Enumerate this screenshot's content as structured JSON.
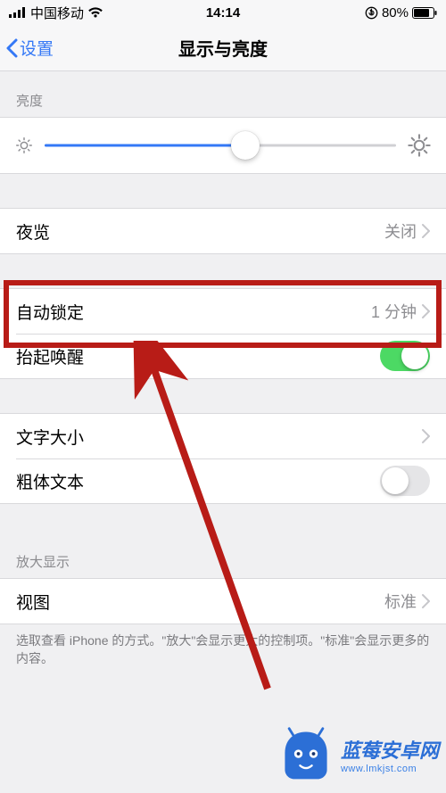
{
  "status": {
    "carrier": "中国移动",
    "time": "14:14",
    "battery_pct": "80%"
  },
  "nav": {
    "back": "设置",
    "title": "显示与亮度"
  },
  "brightness": {
    "header": "亮度",
    "level_pct": 57
  },
  "night_shift": {
    "label": "夜览",
    "value": "关闭"
  },
  "auto_lock": {
    "label": "自动锁定",
    "value": "1 分钟"
  },
  "raise_to_wake": {
    "label": "抬起唤醒",
    "on": true
  },
  "text_size": {
    "label": "文字大小"
  },
  "bold_text": {
    "label": "粗体文本",
    "on": false
  },
  "zoom": {
    "header": "放大显示",
    "view_label": "视图",
    "view_value": "标准",
    "footer": "选取查看 iPhone 的方式。\"放大\"会显示更大的控制项。\"标准\"会显示更多的内容。"
  },
  "watermark": {
    "title": "蓝莓安卓网",
    "url": "www.lmkjst.com"
  }
}
